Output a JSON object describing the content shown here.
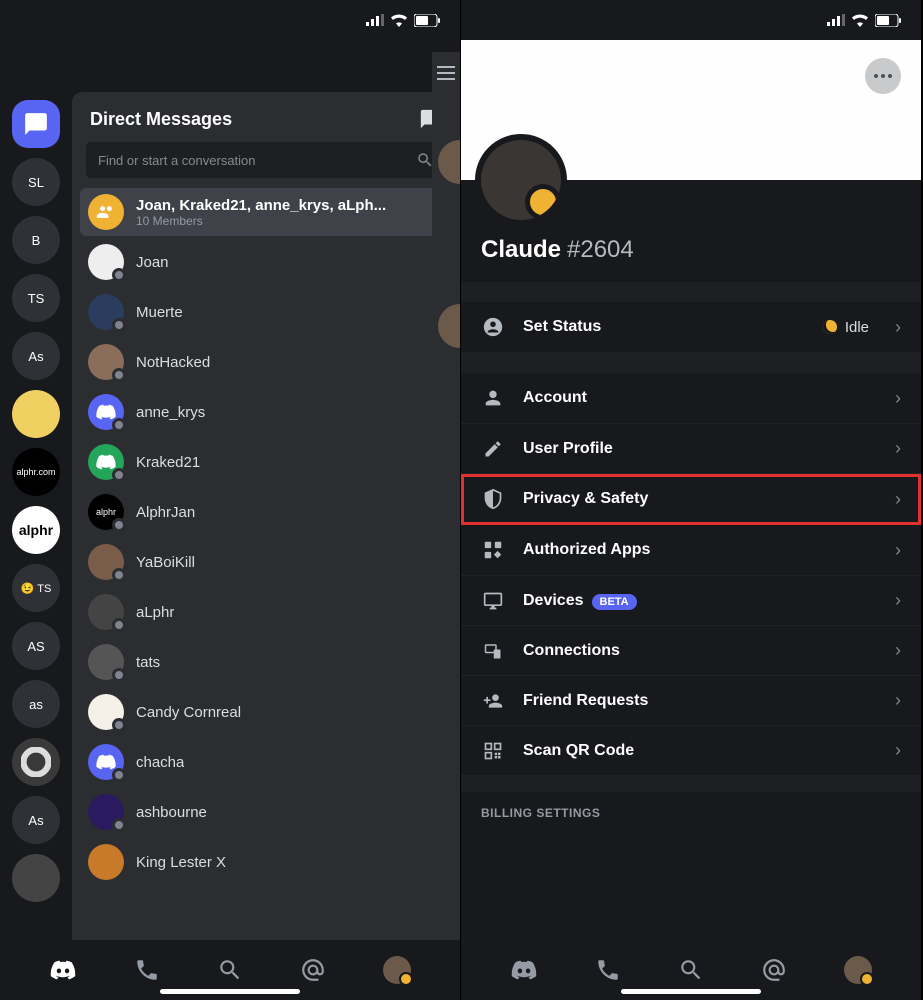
{
  "left": {
    "dm_header": "Direct Messages",
    "search_placeholder": "Find or start a conversation",
    "servers": [
      "",
      "SL",
      "B",
      "TS",
      "As",
      "",
      "alphr.com",
      "alphr",
      "😉 TS",
      "AS",
      "as",
      "",
      "As",
      ""
    ],
    "group_dm": {
      "name": "Joan, Kraked21, anne_krys, aLph...",
      "members": "10 Members"
    },
    "dms": [
      {
        "name": "Joan"
      },
      {
        "name": "Muerte"
      },
      {
        "name": "NotHacked"
      },
      {
        "name": "anne_krys"
      },
      {
        "name": "Kraked21"
      },
      {
        "name": "AlphrJan"
      },
      {
        "name": "YaBoiKill"
      },
      {
        "name": "aLphr"
      },
      {
        "name": "tats"
      },
      {
        "name": "Candy Cornreal"
      },
      {
        "name": "chacha"
      },
      {
        "name": "ashbourne"
      },
      {
        "name": "King Lester X"
      }
    ]
  },
  "right": {
    "username": "Claude",
    "discriminator": "#2604",
    "set_status": {
      "label": "Set Status",
      "value": "Idle"
    },
    "rows": [
      {
        "label": "Account",
        "icon": "person"
      },
      {
        "label": "User Profile",
        "icon": "pencil"
      },
      {
        "label": "Privacy & Safety",
        "icon": "shield",
        "highlight": true
      },
      {
        "label": "Authorized Apps",
        "icon": "apps"
      },
      {
        "label": "Devices",
        "icon": "devices",
        "badge": "BETA"
      },
      {
        "label": "Connections",
        "icon": "connections"
      },
      {
        "label": "Friend Requests",
        "icon": "friend"
      },
      {
        "label": "Scan QR Code",
        "icon": "qr"
      }
    ],
    "billing_header": "BILLING SETTINGS"
  }
}
